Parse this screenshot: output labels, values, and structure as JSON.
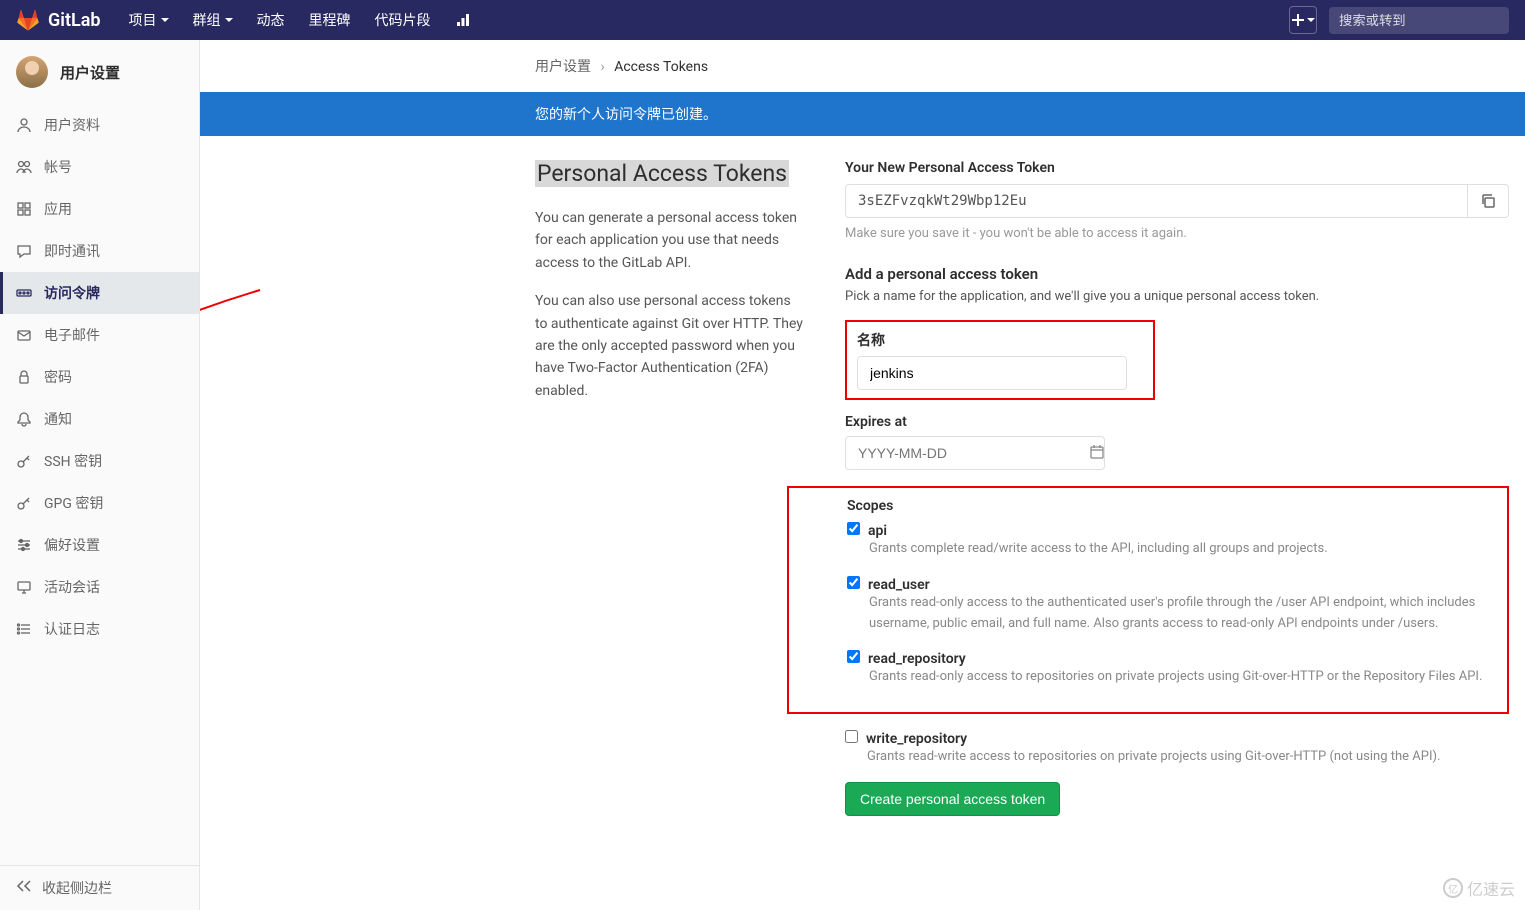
{
  "navbar": {
    "brand": "GitLab",
    "items": [
      "项目",
      "群组",
      "动态",
      "里程碑",
      "代码片段"
    ],
    "plus_label": "+",
    "search_placeholder": "搜索或转到"
  },
  "sidebar": {
    "title": "用户设置",
    "items": [
      {
        "label": "用户资料",
        "icon": "user"
      },
      {
        "label": "帐号",
        "icon": "users"
      },
      {
        "label": "应用",
        "icon": "grid"
      },
      {
        "label": "即时通讯",
        "icon": "chat"
      },
      {
        "label": "访问令牌",
        "icon": "token",
        "active": true
      },
      {
        "label": "电子邮件",
        "icon": "mail"
      },
      {
        "label": "密码",
        "icon": "lock"
      },
      {
        "label": "通知",
        "icon": "bell"
      },
      {
        "label": "SSH 密钥",
        "icon": "key"
      },
      {
        "label": "GPG 密钥",
        "icon": "key"
      },
      {
        "label": "偏好设置",
        "icon": "sliders"
      },
      {
        "label": "活动会话",
        "icon": "monitor"
      },
      {
        "label": "认证日志",
        "icon": "list"
      }
    ],
    "collapse": "收起侧边栏"
  },
  "breadcrumb": {
    "root": "用户设置",
    "current": "Access Tokens"
  },
  "alert": "您的新个人访问令牌已创建。",
  "left": {
    "title": "Personal Access Tokens",
    "p1": "You can generate a personal access token for each application you use that needs access to the GitLab API.",
    "p2": "You can also use personal access tokens to authenticate against Git over HTTP. They are the only accepted password when you have Two-Factor Authentication (2FA) enabled."
  },
  "token": {
    "label": "Your New Personal Access Token",
    "value": "3sEZFvzqkWt29Wbp12Eu",
    "hint": "Make sure you save it - you won't be able to access it again."
  },
  "form": {
    "title": "Add a personal access token",
    "desc": "Pick a name for the application, and we'll give you a unique personal access token.",
    "name_label": "名称",
    "name_value": "jenkins",
    "expires_label": "Expires at",
    "expires_placeholder": "YYYY-MM-DD",
    "scopes_label": "Scopes",
    "scopes": [
      {
        "name": "api",
        "checked": true,
        "desc": "Grants complete read/write access to the API, including all groups and projects."
      },
      {
        "name": "read_user",
        "checked": true,
        "desc": "Grants read-only access to the authenticated user's profile through the /user API endpoint, which includes username, public email, and full name. Also grants access to read-only API endpoints under /users."
      },
      {
        "name": "read_repository",
        "checked": true,
        "desc": "Grants read-only access to repositories on private projects using Git-over-HTTP or the Repository Files API."
      },
      {
        "name": "write_repository",
        "checked": false,
        "desc": "Grants read-write access to repositories on private projects using Git-over-HTTP (not using the API)."
      }
    ],
    "submit": "Create personal access token"
  },
  "watermark": "亿速云"
}
